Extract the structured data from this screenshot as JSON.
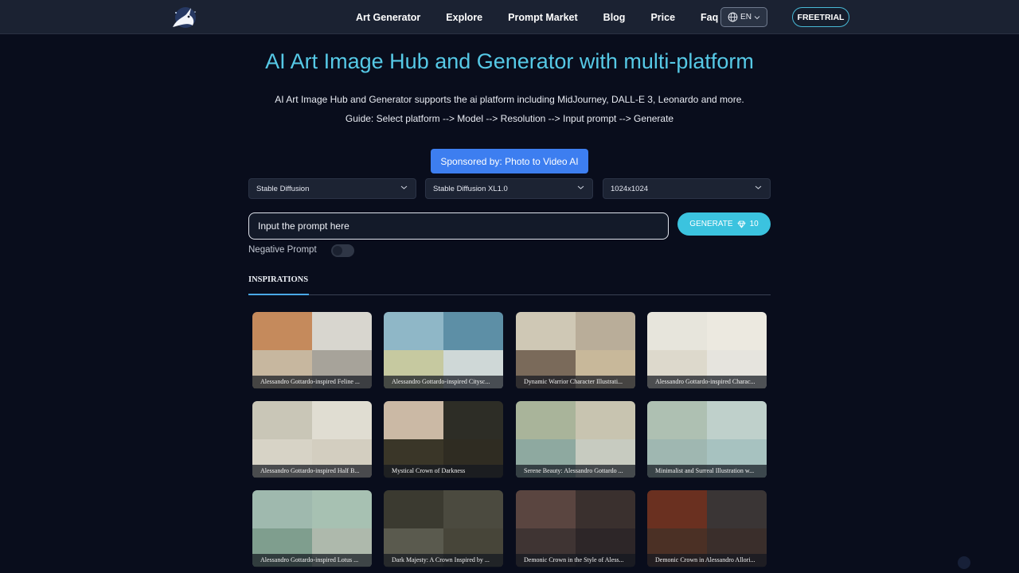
{
  "nav": {
    "links": [
      "Art Generator",
      "Explore",
      "Prompt Market",
      "Blog",
      "Price",
      "Faq"
    ],
    "language": "EN",
    "freetrial_label": "FREETRIAL"
  },
  "hero": {
    "title": "AI Art Image Hub and Generator with multi-platform",
    "subtitle": "AI Art Image Hub and Generator supports the ai platform including MidJourney, DALL-E 3, Leonardo and more.",
    "guide": "Guide: Select platform --> Model --> Resolution --> Input prompt --> Generate"
  },
  "sponsor_label": "Sponsored by: Photo to Video AI",
  "selects": {
    "platform": "Stable Diffusion",
    "model": "Stable Diffusion XL1.0",
    "resolution": "1024x1024"
  },
  "prompt": {
    "placeholder": "Input the prompt here"
  },
  "generate": {
    "label": "GENERATE",
    "cost": "10"
  },
  "negative_prompt_label": "Negative Prompt",
  "tabs": {
    "inspirations": "INSPIRATIONS"
  },
  "cards": [
    {
      "caption": "Alessandro Gottardo-inspired Feline ...",
      "colors": [
        "#c58a5c",
        "#d8d6cf",
        "#c7b79f",
        "#a7a39a"
      ]
    },
    {
      "caption": "Alessandro Gottardo-inspired Citysc...",
      "colors": [
        "#8fb7c7",
        "#5d8fa6",
        "#c6c9a0",
        "#cfd8d7"
      ]
    },
    {
      "caption": "Dynamic Warrior Character Illustrati...",
      "colors": [
        "#cfc8b5",
        "#b9ad99",
        "#7a6a5a",
        "#c8b89a"
      ]
    },
    {
      "caption": "Alessandro Gottardo-inspired Charac...",
      "colors": [
        "#e7e5dc",
        "#ece9e0",
        "#ddd9cc",
        "#e6e4de"
      ]
    },
    {
      "caption": "Alessandro Gottardo-inspired Half B...",
      "colors": [
        "#c9c6b7",
        "#e0ddd2",
        "#d7d3c6",
        "#d3cec0"
      ]
    },
    {
      "caption": "Mystical Crown of Darkness",
      "colors": [
        "#cbb9a5",
        "#2d2d26",
        "#3a3628",
        "#2f2c22"
      ]
    },
    {
      "caption": "Serene Beauty: Alessandro Gottardo ...",
      "colors": [
        "#a9b49a",
        "#c8c4b0",
        "#8ea9a0",
        "#c7cbc0"
      ]
    },
    {
      "caption": "Minimalist and Surreal Illustration w...",
      "colors": [
        "#aec0b2",
        "#bfd0cb",
        "#9fb7b1",
        "#a7c2c0"
      ]
    },
    {
      "caption": "Alessandro Gottardo-inspired Lotus ...",
      "colors": [
        "#9fb9ae",
        "#a7c1b2",
        "#7f9e8e",
        "#aeb9ac"
      ]
    },
    {
      "caption": "Dark Majesty: A Crown Inspired by ...",
      "colors": [
        "#3b3a30",
        "#4b4a3f",
        "#5a5a4e",
        "#474539"
      ]
    },
    {
      "caption": "Demonic Crown in the Style of Aless...",
      "colors": [
        "#5a4540",
        "#3a302e",
        "#3f3433",
        "#2d2628"
      ]
    },
    {
      "caption": "Demonic Crown in Alessandro Allori...",
      "colors": [
        "#6a3020",
        "#3a3535",
        "#4b3025",
        "#3a2e2b"
      ]
    }
  ]
}
